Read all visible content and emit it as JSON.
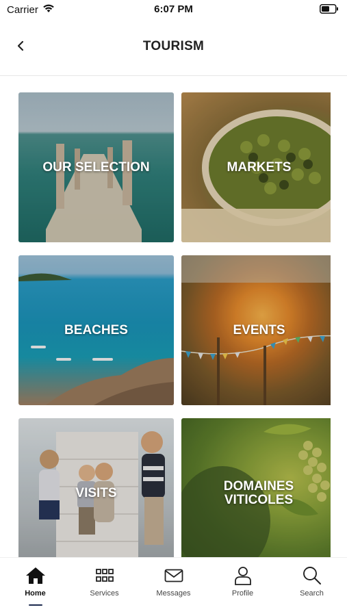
{
  "status_bar": {
    "carrier": "Carrier",
    "time": "6:07 PM"
  },
  "header": {
    "title": "TOURISM",
    "back_icon": "chevron-left-icon"
  },
  "tiles": [
    {
      "label": "OUR SELECTION"
    },
    {
      "label": "MARKETS"
    },
    {
      "label": "BEACHES"
    },
    {
      "label": "EVENTS"
    },
    {
      "label": "VISITS"
    },
    {
      "label": "DOMAINES VITICOLES"
    }
  ],
  "tabbar": {
    "active_color": "#1c2a4f",
    "items": [
      {
        "label": "Home",
        "icon": "home-icon",
        "active": true
      },
      {
        "label": "Services",
        "icon": "grid-icon",
        "active": false
      },
      {
        "label": "Messages",
        "icon": "envelope-icon",
        "active": false
      },
      {
        "label": "Profile",
        "icon": "person-icon",
        "active": false
      },
      {
        "label": "Search",
        "icon": "search-icon",
        "active": false
      }
    ]
  }
}
